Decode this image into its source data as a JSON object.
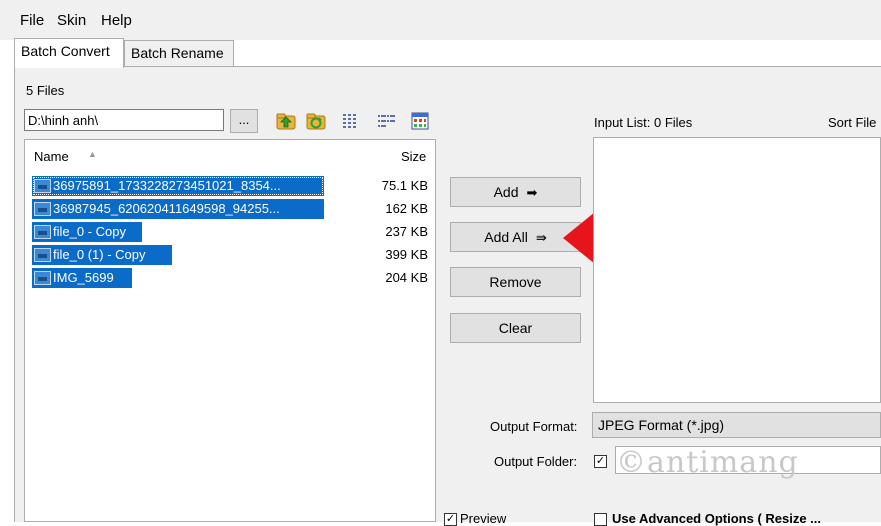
{
  "menu": [
    "File",
    "Skin",
    "Help"
  ],
  "tabs": [
    "Batch Convert",
    "Batch Rename"
  ],
  "files_count": "5 Files",
  "path": "D:\\hinh anh\\",
  "browse_label": "...",
  "list": {
    "col_name": "Name",
    "col_size": "Size",
    "rows": [
      {
        "name": "36975891_1733228273451021_8354...",
        "size": "75.1 KB"
      },
      {
        "name": "36987945_620620411649598_94255...",
        "size": "162 KB"
      },
      {
        "name": "file_0 - Copy",
        "size": "237 KB"
      },
      {
        "name": "file_0 (1) - Copy",
        "size": "399 KB"
      },
      {
        "name": "IMG_5699",
        "size": "204 KB"
      }
    ]
  },
  "buttons": {
    "add": "Add",
    "add_all": "Add All",
    "remove": "Remove",
    "clear": "Clear"
  },
  "input_list_label": "Input List:  0 Files",
  "sort_label": "Sort File",
  "output_format_label": "Output Format:",
  "output_format_value": "JPEG Format (*.jpg)",
  "output_folder_label": "Output Folder:",
  "watermark": "©antimang",
  "bottom": {
    "preview": "Preview",
    "advanced": "Use Advanced Options ( Resize ..."
  },
  "colors": {
    "selection": "#0b6bc9",
    "annotation_arrow": "#e8141b"
  }
}
